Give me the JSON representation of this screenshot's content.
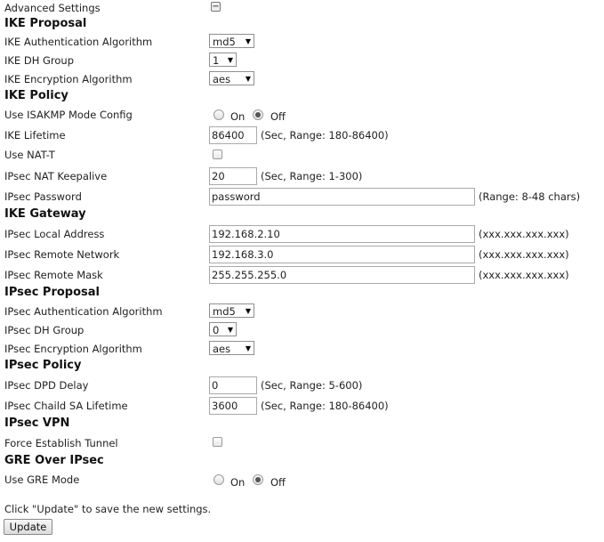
{
  "advanced": {
    "label": "Advanced Settings",
    "toggle_symbol": "−"
  },
  "ike_proposal": {
    "title": "IKE Proposal",
    "auth_label": "IKE Authentication Algorithm",
    "auth_value": "md5",
    "dh_label": "IKE DH Group",
    "dh_value": "1",
    "enc_label": "IKE Encryption Algorithm",
    "enc_value": "aes"
  },
  "ike_policy": {
    "title": "IKE Policy",
    "isakmp_label": "Use ISAKMP Mode Config",
    "on_label": "On",
    "off_label": "Off",
    "isakmp_selected": "Off",
    "lifetime_label": "IKE Lifetime",
    "lifetime_value": "86400",
    "lifetime_hint": "(Sec, Range: 180-86400)",
    "natt_label": "Use NAT-T",
    "natt_checked": false,
    "keepalive_label": "IPsec NAT Keepalive",
    "keepalive_value": "20",
    "keepalive_hint": "(Sec, Range: 1-300)",
    "password_label": "IPsec Password",
    "password_value": "password",
    "password_hint": "(Range: 8-48 chars)"
  },
  "ike_gateway": {
    "title": "IKE Gateway",
    "local_label": "IPsec Local Address",
    "local_value": "192.168.2.10",
    "remote_net_label": "IPsec Remote Network",
    "remote_net_value": "192.168.3.0",
    "remote_mask_label": "IPsec Remote Mask",
    "remote_mask_value": "255.255.255.0",
    "ip_hint": "(xxx.xxx.xxx.xxx)"
  },
  "ipsec_proposal": {
    "title": "IPsec Proposal",
    "auth_label": "IPsec Authentication Algorithm",
    "auth_value": "md5",
    "dh_label": "IPsec DH Group",
    "dh_value": "0",
    "enc_label": "IPsec Encryption Algorithm",
    "enc_value": "aes"
  },
  "ipsec_policy": {
    "title": "IPsec Policy",
    "dpd_label": "IPsec DPD Delay",
    "dpd_value": "0",
    "dpd_hint": "(Sec, Range: 5-600)",
    "sa_label": "IPsec Chaild SA Lifetime",
    "sa_value": "3600",
    "sa_hint": "(Sec, Range: 180-86400)"
  },
  "ipsec_vpn": {
    "title": "IPsec VPN",
    "force_label": "Force Establish Tunnel",
    "force_checked": false
  },
  "gre": {
    "title": "GRE Over IPsec",
    "mode_label": "Use GRE Mode",
    "on_label": "On",
    "off_label": "Off",
    "mode_selected": "Off"
  },
  "footer": {
    "note": "Click \"Update\" to save the new settings.",
    "update_label": "Update"
  }
}
